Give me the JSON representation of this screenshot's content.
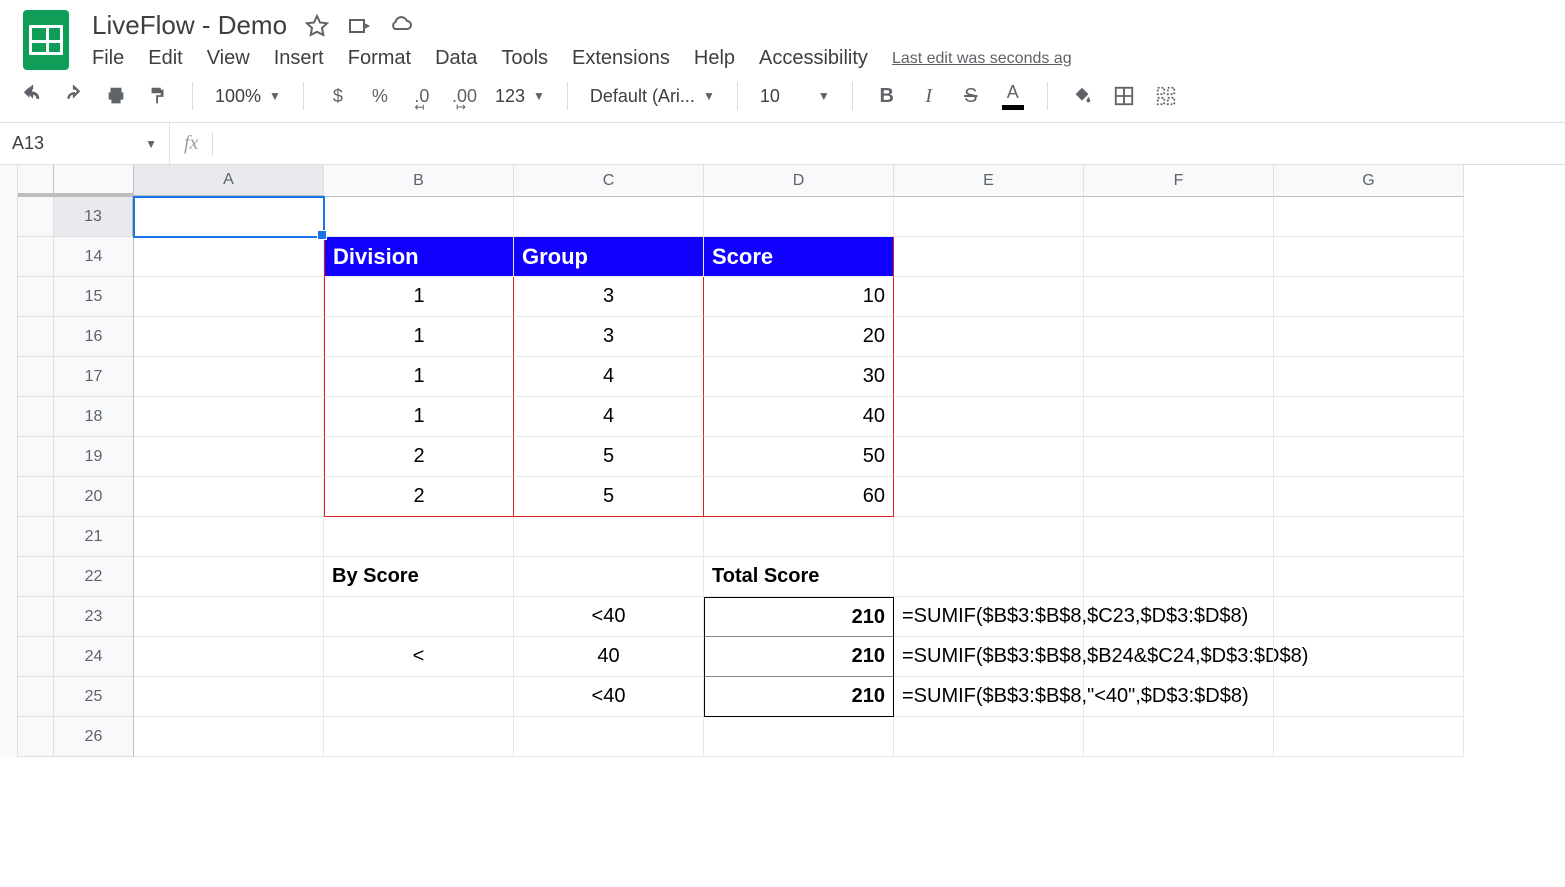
{
  "doc": {
    "title": "LiveFlow - Demo"
  },
  "menus": {
    "file": "File",
    "edit": "Edit",
    "view": "View",
    "insert": "Insert",
    "format": "Format",
    "data": "Data",
    "tools": "Tools",
    "extensions": "Extensions",
    "help": "Help",
    "accessibility": "Accessibility",
    "last_edit": "Last edit was seconds ag"
  },
  "toolbar": {
    "zoom": "100%",
    "currency": "$",
    "percent": "%",
    "dec_dec": ".0",
    "inc_dec": ".00",
    "more_fmt": "123",
    "font": "Default (Ari...",
    "size": "10",
    "bold": "B",
    "italic": "I",
    "strike": "S",
    "text_color": "A"
  },
  "namebox": "A13",
  "cols": [
    "A",
    "B",
    "C",
    "D",
    "E",
    "F",
    "G"
  ],
  "rows": [
    "13",
    "14",
    "15",
    "16",
    "17",
    "18",
    "19",
    "20",
    "21",
    "22",
    "23",
    "24",
    "25",
    "26"
  ],
  "table": {
    "headers": {
      "division": "Division",
      "group": "Group",
      "score": "Score"
    },
    "data": [
      {
        "division": "1",
        "group": "3",
        "score": "10"
      },
      {
        "division": "1",
        "group": "3",
        "score": "20"
      },
      {
        "division": "1",
        "group": "4",
        "score": "30"
      },
      {
        "division": "1",
        "group": "4",
        "score": "40"
      },
      {
        "division": "2",
        "group": "5",
        "score": "50"
      },
      {
        "division": "2",
        "group": "5",
        "score": "60"
      }
    ]
  },
  "summary": {
    "by_score": "By Score",
    "total_score": "Total Score",
    "rows": [
      {
        "b": "",
        "c": "<40",
        "d": "210",
        "e": "=SUMIF($B$3:$B$8,$C23,$D$3:$D$8)"
      },
      {
        "b": "<",
        "c": "40",
        "d": "210",
        "e": "=SUMIF($B$3:$B$8,$B24&$C24,$D$3:$D$8)"
      },
      {
        "b": "",
        "c": "<40",
        "d": "210",
        "e": "=SUMIF($B$3:$B$8,\"<40\",$D$3:$D$8)"
      }
    ]
  }
}
